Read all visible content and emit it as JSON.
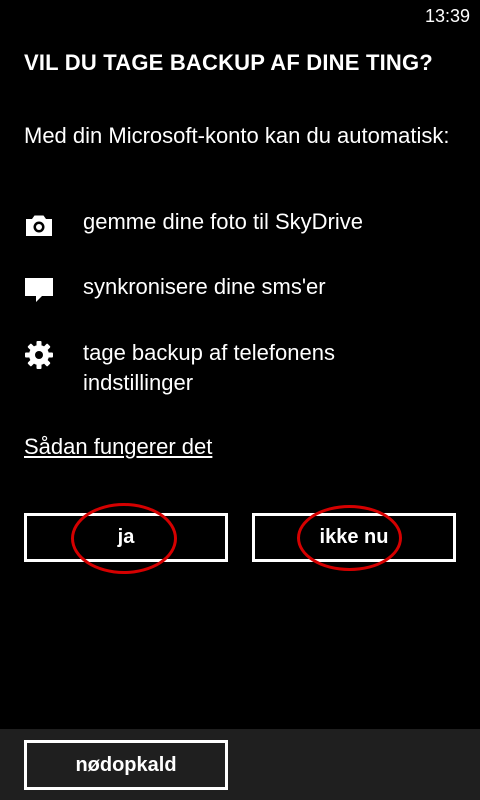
{
  "status_bar": {
    "time": "13:39"
  },
  "title": "VIL DU TAGE BACKUP AF DINE TING?",
  "intro": "Med din Microsoft-konto kan du automatisk:",
  "features": [
    {
      "icon": "camera-icon",
      "text": "gemme dine foto til SkyDrive"
    },
    {
      "icon": "message-icon",
      "text": "synkronisere dine sms'er"
    },
    {
      "icon": "gear-icon",
      "text": "tage backup af telefonens indstillinger"
    }
  ],
  "help_link": "Sådan fungerer det",
  "buttons": {
    "yes": "ja",
    "not_now": "ikke nu"
  },
  "bottom_bar": {
    "emergency": "nødopkald"
  },
  "colors": {
    "background": "#000000",
    "foreground": "#ffffff",
    "annotation": "#d50000",
    "bottom_bar": "#1f1f1f"
  }
}
